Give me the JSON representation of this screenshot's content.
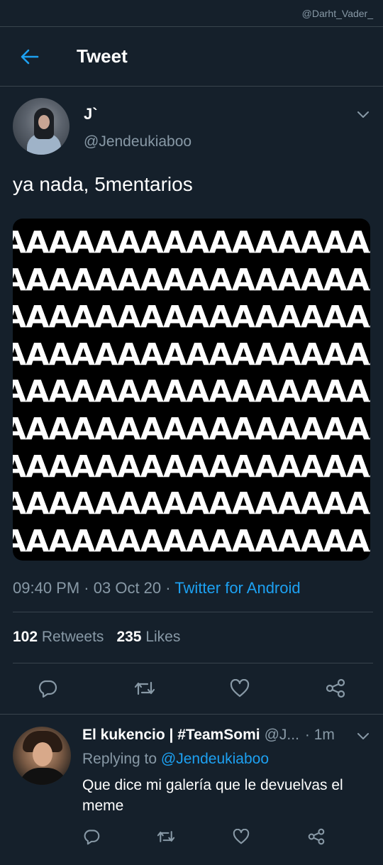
{
  "status_bar": {
    "watermark": "@Darht_Vader_"
  },
  "header": {
    "title": "Tweet"
  },
  "tweet": {
    "author_name": "J`",
    "author_handle": "@Jendeukiaboo",
    "text": "ya nada, 5mentarios",
    "media_rows": [
      "AAAAAAAAAAAAAAAAAAAAA",
      "AAAAAAAAAAAAAAAAAAAAA",
      "AAAAAAAAAAAAAAAAAAAAA",
      "AAAAAAAAAAAAAAAAAAAAA",
      "AAAAAAAAAAAAAAAAAAAAA",
      "AAAAAAAAAAAAAAAAAAAAA",
      "AAAAAAAAAAAAAAAAAAAAA",
      "AAAAAAAAAAAAAAAAAAAAA",
      "AAAAAAAAAAAAAAAAAAAAA"
    ],
    "time": "09:40 PM",
    "date": "03 Oct 20",
    "separator": "·",
    "source": "Twitter for Android",
    "retweets_count": "102",
    "retweets_label": "Retweets",
    "likes_count": "235",
    "likes_label": "Likes"
  },
  "reply": {
    "name": "El kukencio | #TeamSomi",
    "handle": "@J...",
    "time": "· 1m",
    "replying_label": "Replying to",
    "replying_to": "@Jendeukiaboo",
    "text": "Que dice mi galería que le devuelvas el meme"
  },
  "icons": {
    "back": "arrow-left-icon",
    "more": "chevron-down-icon",
    "reply": "reply-icon",
    "retweet": "retweet-icon",
    "like": "heart-icon",
    "share": "share-icon"
  },
  "colors": {
    "background": "#15202b",
    "divider": "#38444d",
    "accent": "#1da1f2",
    "secondary_text": "#8899a6",
    "primary_text": "#ffffff"
  }
}
